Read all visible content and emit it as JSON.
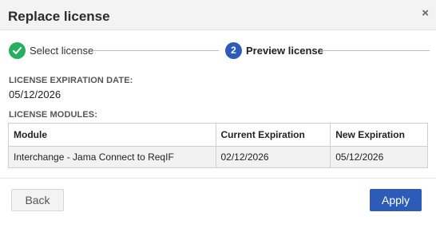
{
  "dialog": {
    "title": "Replace license",
    "close_glyph": "×"
  },
  "steps": [
    {
      "status": "complete",
      "icon": "check-icon",
      "label": "Select license"
    },
    {
      "status": "active",
      "number": "2",
      "label": "Preview license"
    }
  ],
  "expiration": {
    "label": "LICENSE EXPIRATION DATE:",
    "value": "05/12/2026"
  },
  "modules": {
    "label": "LICENSE MODULES:",
    "columns": [
      "Module",
      "Current Expiration",
      "New Expiration"
    ],
    "rows": [
      [
        "Interchange - Jama Connect to ReqIF",
        "02/12/2026",
        "05/12/2026"
      ]
    ]
  },
  "buttons": {
    "back": "Back",
    "apply": "Apply"
  },
  "colors": {
    "complete_green": "#27ae60",
    "primary_blue": "#2c5bb8"
  }
}
